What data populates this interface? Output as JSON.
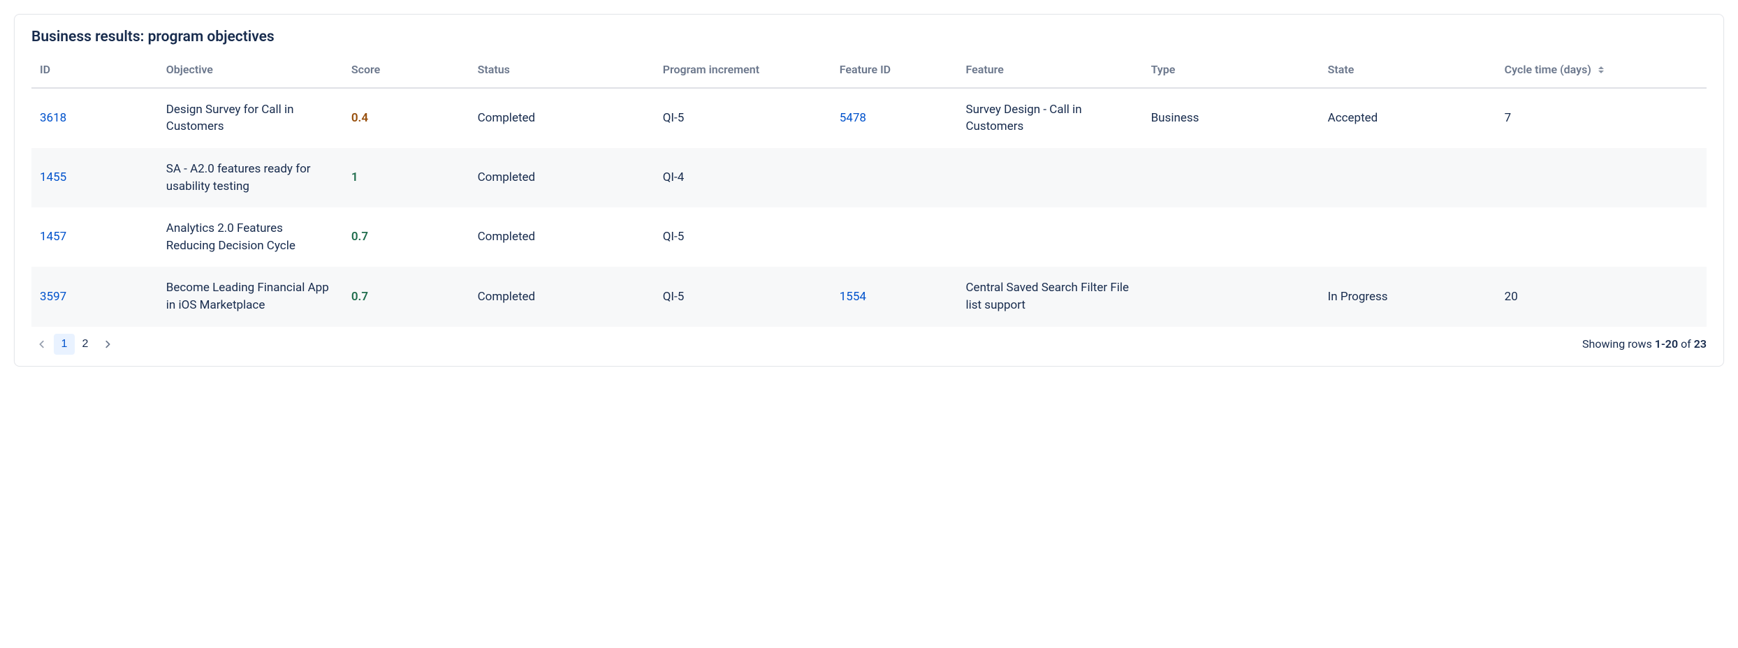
{
  "panel": {
    "title": "Business results: program objectives"
  },
  "columns": {
    "id": "ID",
    "objective": "Objective",
    "score": "Score",
    "status": "Status",
    "program_increment": "Program increment",
    "feature_id": "Feature ID",
    "feature": "Feature",
    "type": "Type",
    "state": "State",
    "cycle_time": "Cycle time (days)"
  },
  "rows": [
    {
      "id": "3618",
      "objective": "Design Survey for Call in Customers",
      "score": "0.4",
      "score_band": "low",
      "status": "Completed",
      "program_increment": "QI-5",
      "feature_id": "5478",
      "feature": "Survey Design - Call in Customers",
      "type": "Business",
      "state": "Accepted",
      "cycle_time": "7"
    },
    {
      "id": "1455",
      "objective": "SA - A2.0 features ready for usability testing",
      "score": "1",
      "score_band": "high",
      "status": "Completed",
      "program_increment": "QI-4",
      "feature_id": "",
      "feature": "",
      "type": "",
      "state": "",
      "cycle_time": ""
    },
    {
      "id": "1457",
      "objective": "Analytics 2.0 Features Reducing Decision Cycle",
      "score": "0.7",
      "score_band": "high",
      "status": "Completed",
      "program_increment": "QI-5",
      "feature_id": "",
      "feature": "",
      "type": "",
      "state": "",
      "cycle_time": ""
    },
    {
      "id": "3597",
      "objective": "Become Leading Financial App in iOS Marketplace",
      "score": "0.7",
      "score_band": "high",
      "status": "Completed",
      "program_increment": "QI-5",
      "feature_id": "1554",
      "feature": "Central Saved Search Filter File list support",
      "type": "",
      "state": "In Progress",
      "cycle_time": "20"
    }
  ],
  "pagination": {
    "pages": [
      "1",
      "2"
    ],
    "current": "1",
    "summary_prefix": "Showing rows ",
    "summary_range": "1-20",
    "summary_mid": " of ",
    "summary_total": "23"
  }
}
